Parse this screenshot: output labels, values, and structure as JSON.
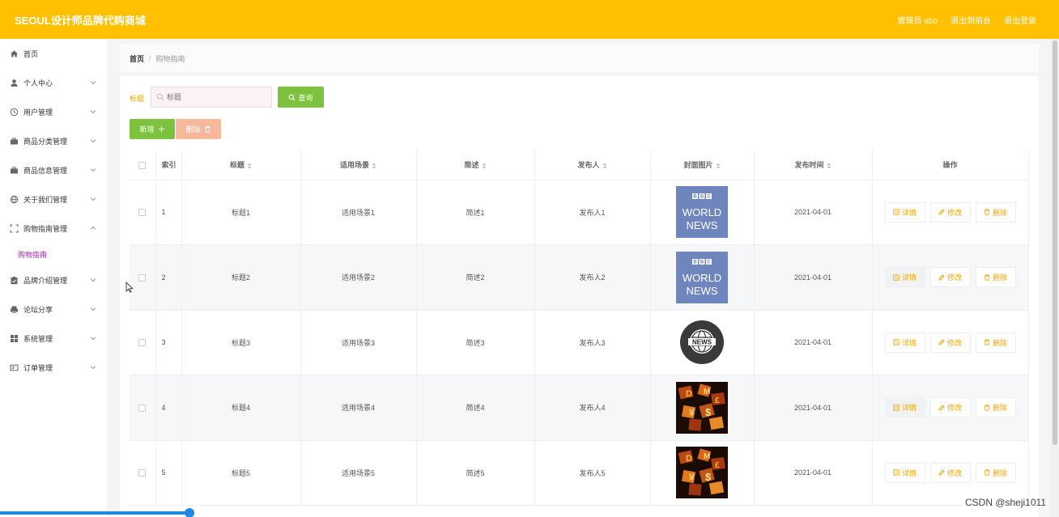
{
  "header": {
    "title": "SEOUL设计师品牌代购商城",
    "admin": "管理员 abo",
    "exit_front": "退出到前台",
    "logout": "退出登录",
    "bg": "#ffc000"
  },
  "sidebar": {
    "items": [
      {
        "label": "首页",
        "icon": "home-icon"
      },
      {
        "label": "个人中心",
        "icon": "user-icon"
      },
      {
        "label": "用户管理",
        "icon": "clock-icon"
      },
      {
        "label": "商品分类管理",
        "icon": "briefcase-icon"
      },
      {
        "label": "商品信息管理",
        "icon": "briefcase-icon"
      },
      {
        "label": "关于我们管理",
        "icon": "globe-icon"
      },
      {
        "label": "购物指南管理",
        "icon": "fullscreen-icon"
      },
      {
        "label": "品牌介绍管理",
        "icon": "clipboard-icon"
      },
      {
        "label": "论坛分享",
        "icon": "printer-icon"
      },
      {
        "label": "系统管理",
        "icon": "grid-icon"
      },
      {
        "label": "订单管理",
        "icon": "card-icon"
      }
    ],
    "sub_active": "购物指南"
  },
  "breadcrumb": {
    "home": "首页",
    "sep": "/",
    "current": "购物指南"
  },
  "search": {
    "label": "标题",
    "placeholder": "标题",
    "button": "查询"
  },
  "actions": {
    "add": "新增",
    "delete": "删除"
  },
  "table": {
    "columns": [
      "索引",
      "标题",
      "适用场景",
      "简述",
      "发布人",
      "封面图片",
      "发布时间",
      "操作"
    ],
    "rows": [
      {
        "index": "1",
        "title": "标题1",
        "scene": "适用场景1",
        "summary": "简述1",
        "publisher": "发布人1",
        "cover": "bbc-world-news-image",
        "date": "2021-04-01"
      },
      {
        "index": "2",
        "title": "标题2",
        "scene": "适用场景2",
        "summary": "简述2",
        "publisher": "发布人2",
        "cover": "bbc-world-news-image",
        "date": "2021-04-01"
      },
      {
        "index": "3",
        "title": "标题3",
        "scene": "适用场景3",
        "summary": "简述3",
        "publisher": "发布人3",
        "cover": "news-globe-image",
        "date": "2021-04-01"
      },
      {
        "index": "4",
        "title": "标题4",
        "scene": "适用场景4",
        "summary": "简述4",
        "publisher": "发布人4",
        "cover": "currency-fire-image",
        "date": "2021-04-01"
      },
      {
        "index": "5",
        "title": "标题5",
        "scene": "适用场景5",
        "summary": "简述5",
        "publisher": "发布人5",
        "cover": "currency-fire-image",
        "date": "2021-04-01"
      }
    ],
    "op_detail": "详情",
    "op_edit": "修改",
    "op_delete": "删除"
  },
  "watermark": "CSDN @sheji1011",
  "colors": {
    "accent": "#ffc000",
    "green": "#7cc23e",
    "delete_light": "#f8b89c",
    "link": "#f0a500",
    "sub_active": "#9c27b0"
  }
}
